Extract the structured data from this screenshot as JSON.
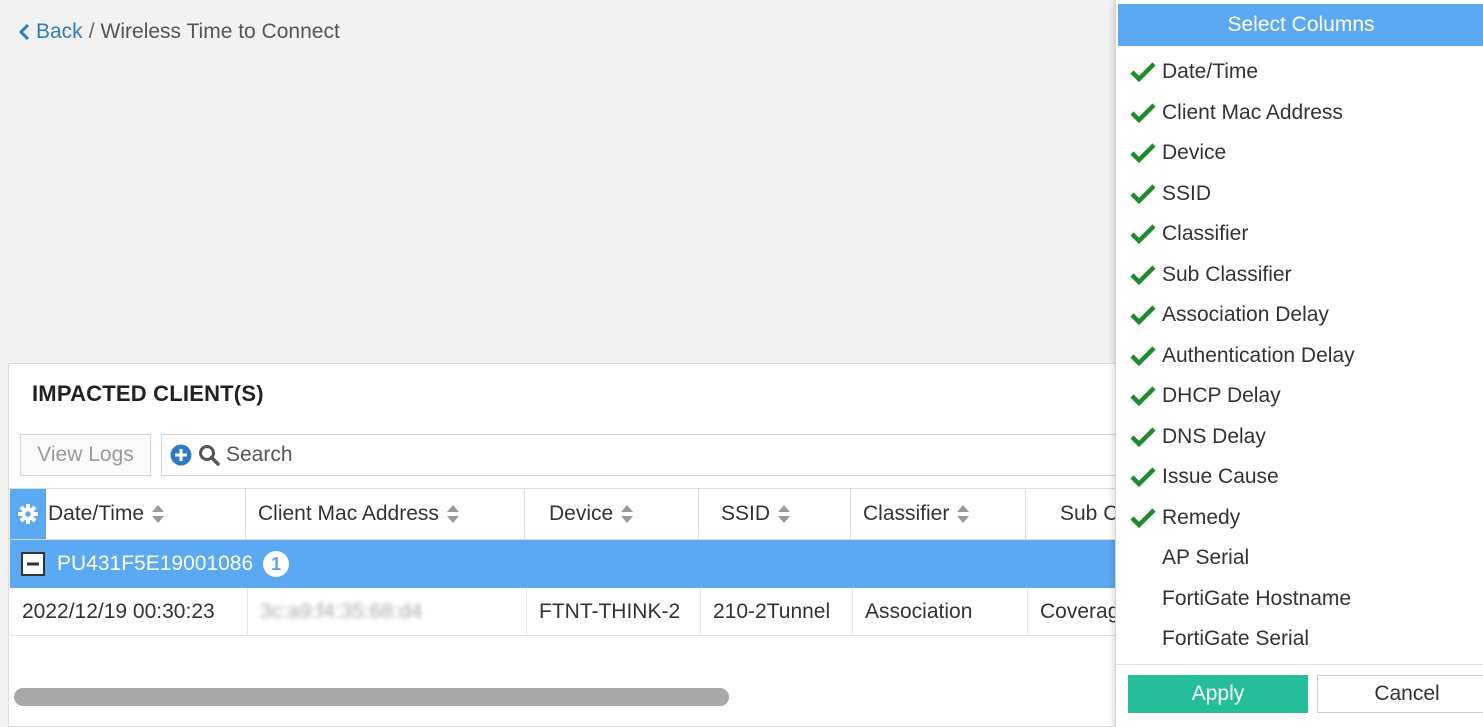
{
  "breadcrumb": {
    "back_label": "Back",
    "separator": "/",
    "title": "Wireless Time to Connect"
  },
  "panel": {
    "title": "IMPACTED CLIENT(S)",
    "view_logs_label": "View Logs",
    "search_placeholder": "Search"
  },
  "table": {
    "columns": [
      "Date/Time",
      "Client Mac Address",
      "Device",
      "SSID",
      "Classifier",
      "Sub C"
    ],
    "group": {
      "label": "PU431F5E19001086",
      "count": "1"
    },
    "rows": [
      {
        "date_time": "2022/12/19 00:30:23",
        "client_mac": "3c:a9:f4:35:68:d4",
        "device": "FTNT-THINK-2",
        "ssid": "210-2Tunnel",
        "classifier": "Association",
        "sub_classifier": "Coverag"
      }
    ]
  },
  "column_selector": {
    "title": "Select Columns",
    "items": [
      {
        "label": "Date/Time",
        "checked": true
      },
      {
        "label": "Client Mac Address",
        "checked": true
      },
      {
        "label": "Device",
        "checked": true
      },
      {
        "label": "SSID",
        "checked": true
      },
      {
        "label": "Classifier",
        "checked": true
      },
      {
        "label": "Sub Classifier",
        "checked": true
      },
      {
        "label": "Association Delay",
        "checked": true
      },
      {
        "label": "Authentication Delay",
        "checked": true
      },
      {
        "label": "DHCP Delay",
        "checked": true
      },
      {
        "label": "DNS Delay",
        "checked": true
      },
      {
        "label": "Issue Cause",
        "checked": true
      },
      {
        "label": "Remedy",
        "checked": true
      },
      {
        "label": "AP Serial",
        "checked": false
      },
      {
        "label": "FortiGate Hostname",
        "checked": false
      },
      {
        "label": "FortiGate Serial",
        "checked": false
      }
    ],
    "apply_label": "Apply",
    "cancel_label": "Cancel"
  },
  "colors": {
    "accent_blue": "#5aa9f2",
    "link_blue": "#2e7bc4",
    "check_green": "#1e8a2e",
    "apply_green": "#26be9a"
  },
  "icons": [
    "chevron-left-icon",
    "plus-circle-icon",
    "search-icon",
    "gear-icon",
    "sort-icon",
    "minus-square-icon",
    "check-icon"
  ]
}
